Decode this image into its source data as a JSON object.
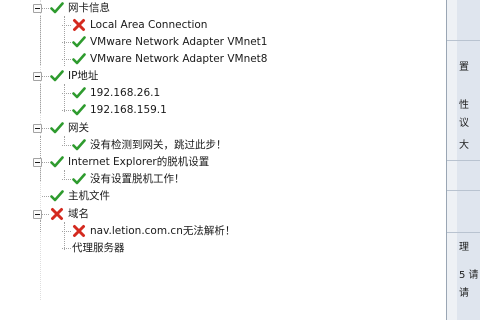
{
  "tree": [
    {
      "label": "网卡信息",
      "status": "ok",
      "expandable": true
    },
    {
      "label": "Local Area Connection",
      "status": "error",
      "expandable": false
    },
    {
      "label": "VMware Network Adapter VMnet1",
      "status": "ok",
      "expandable": false
    },
    {
      "label": "VMware Network Adapter VMnet8",
      "status": "ok",
      "expandable": false
    },
    {
      "label": "IP地址",
      "status": "ok",
      "expandable": true
    },
    {
      "label": "192.168.26.1",
      "status": "ok",
      "expandable": false
    },
    {
      "label": "192.168.159.1",
      "status": "ok",
      "expandable": false
    },
    {
      "label": "网关",
      "status": "ok",
      "expandable": true
    },
    {
      "label": "没有检测到网关，跳过此步！",
      "status": "ok",
      "expandable": false
    },
    {
      "label": "Internet Explorer的脱机设置",
      "status": "ok",
      "expandable": true
    },
    {
      "label": "没有设置脱机工作！",
      "status": "ok",
      "expandable": false
    },
    {
      "label": "主机文件",
      "status": "ok",
      "expandable": false
    },
    {
      "label": "域名",
      "status": "error",
      "expandable": true
    },
    {
      "label": "nav.letion.com.cn无法解析！",
      "status": "error",
      "expandable": false
    },
    {
      "label": "代理服务器",
      "status": "none",
      "expandable": false
    }
  ],
  "right_panel": {
    "texts": [
      "置",
      "性",
      "议",
      "大",
      "理",
      "5 请",
      "请"
    ]
  },
  "colors": {
    "ok": "#2e9b2e",
    "error": "#d42a1f",
    "tree_line": "#a3a3a3"
  }
}
